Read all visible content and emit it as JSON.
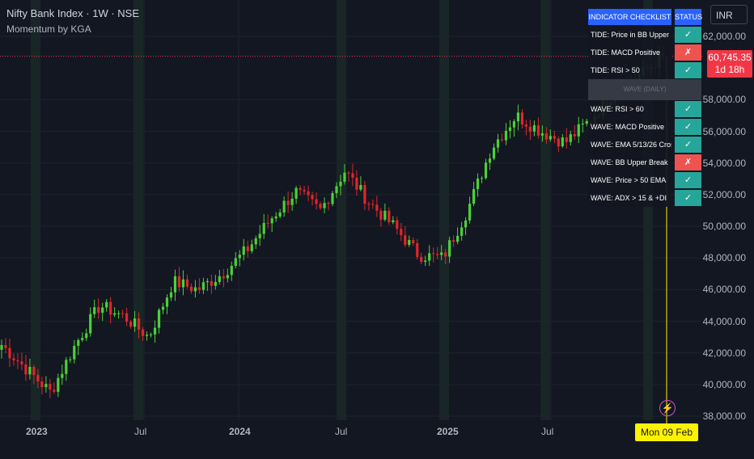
{
  "header": {
    "title": "Nifty Bank Index · 1W · NSE",
    "indicator": "Momentum by KGA"
  },
  "price_axis": {
    "currency": "INR",
    "labels": [
      "62,000.00",
      "58,000.00",
      "56,000.00",
      "54,000.00",
      "52,000.00",
      "50,000.00",
      "48,000.00",
      "46,000.00",
      "44,000.00",
      "42,000.00",
      "40,000.00",
      "38,000.00"
    ]
  },
  "time_axis": {
    "labels": [
      "2023",
      "Jul",
      "2024",
      "Jul",
      "2025",
      "Jul"
    ]
  },
  "last_price": {
    "value": "60,745.35",
    "countdown": "1d 18h"
  },
  "crosshair_date": "Mon 09 Feb '26",
  "checklist": {
    "header_label": "INDICATOR CHECKLIST",
    "header_status": "STATUS",
    "middle_label": "WAVE (DAILY)",
    "rows": [
      {
        "label": "TIDE: Price in BB Upper Half",
        "status": "✓",
        "pass": true
      },
      {
        "label": "TIDE: MACD Positive",
        "status": "✗",
        "pass": false
      },
      {
        "label": "TIDE: RSI > 50",
        "status": "✓",
        "pass": true
      },
      {
        "label": "WAVE: RSI > 60",
        "status": "✓",
        "pass": true
      },
      {
        "label": "WAVE: MACD Positive",
        "status": "✓",
        "pass": true
      },
      {
        "label": "WAVE: EMA 5/13/26 Cross",
        "status": "✓",
        "pass": true
      },
      {
        "label": "WAVE: BB Upper Break",
        "status": "✗",
        "pass": false
      },
      {
        "label": "WAVE: Price > 50 EMA",
        "status": "✓",
        "pass": true
      },
      {
        "label": "WAVE: ADX > 15 & +DI",
        "status": "✓",
        "pass": true
      }
    ]
  },
  "colors": {
    "up": "#4cd137",
    "down": "#e0262c",
    "background": "#131722",
    "table_header": "#2962ff",
    "pass": "#26a69a",
    "fail": "#ef5350",
    "crosshair": "#fff200"
  },
  "chart_data": {
    "type": "candlestick",
    "y_range": [
      37000,
      63000
    ],
    "series": [
      {
        "name": "Nifty Bank Index weekly close",
        "x": [
          "2023-01",
          "2023-03",
          "2023-04",
          "2023-05",
          "2023-07",
          "2023-09",
          "2023-10",
          "2023-12",
          "2024-01",
          "2024-03",
          "2024-05",
          "2024-06",
          "2024-07",
          "2024-08",
          "2024-09",
          "2024-10",
          "2024-12",
          "2025-01",
          "2025-03",
          "2025-04",
          "2025-05",
          "2025-07",
          "2025-08",
          "2025-09",
          "2025-10",
          "2025-11",
          "2026-01",
          "2026-02"
        ],
        "values": [
          42500,
          41000,
          39500,
          42500,
          45000,
          44300,
          43000,
          46500,
          46000,
          47000,
          48500,
          50500,
          52200,
          51000,
          53500,
          51500,
          50000,
          48200,
          48000,
          51000,
          55000,
          57000,
          56000,
          55300,
          56700,
          58500,
          59500,
          60745
        ]
      }
    ]
  }
}
